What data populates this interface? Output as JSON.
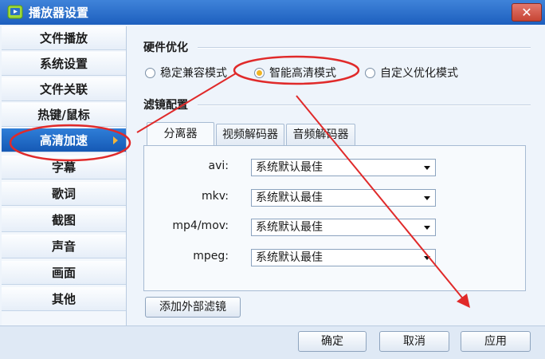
{
  "window": {
    "title": "播放器设置",
    "close_glyph": "✕"
  },
  "sidebar": {
    "items": [
      {
        "label": "文件播放"
      },
      {
        "label": "系统设置"
      },
      {
        "label": "文件关联"
      },
      {
        "label": "热键/鼠标"
      },
      {
        "label": "高清加速",
        "active": true
      },
      {
        "label": "字幕"
      },
      {
        "label": "歌词"
      },
      {
        "label": "截图"
      },
      {
        "label": "声音"
      },
      {
        "label": "画面"
      },
      {
        "label": "其他"
      }
    ]
  },
  "hardware": {
    "title": "硬件优化",
    "options": [
      {
        "label": "稳定兼容模式",
        "checked": false
      },
      {
        "label": "智能高清模式",
        "checked": true
      },
      {
        "label": "自定义优化模式",
        "checked": false
      }
    ]
  },
  "filter": {
    "title": "滤镜配置",
    "tabs": [
      {
        "label": "分离器",
        "active": true
      },
      {
        "label": "视频解码器"
      },
      {
        "label": "音频解码器"
      }
    ],
    "rows": [
      {
        "label": "avi:",
        "value": "系统默认最佳"
      },
      {
        "label": "mkv:",
        "value": "系统默认最佳"
      },
      {
        "label": "mp4/mov:",
        "value": "系统默认最佳"
      },
      {
        "label": "mpeg:",
        "value": "系统默认最佳"
      }
    ],
    "add_button": "添加外部滤镜"
  },
  "footer": {
    "ok": "确定",
    "cancel": "取消",
    "apply": "应用"
  },
  "colors": {
    "title_bar": "#2b6fcf",
    "accent_blue": "#1f66c4",
    "annotation_red": "#e02a2a",
    "radio_checked": "#f0b424"
  }
}
